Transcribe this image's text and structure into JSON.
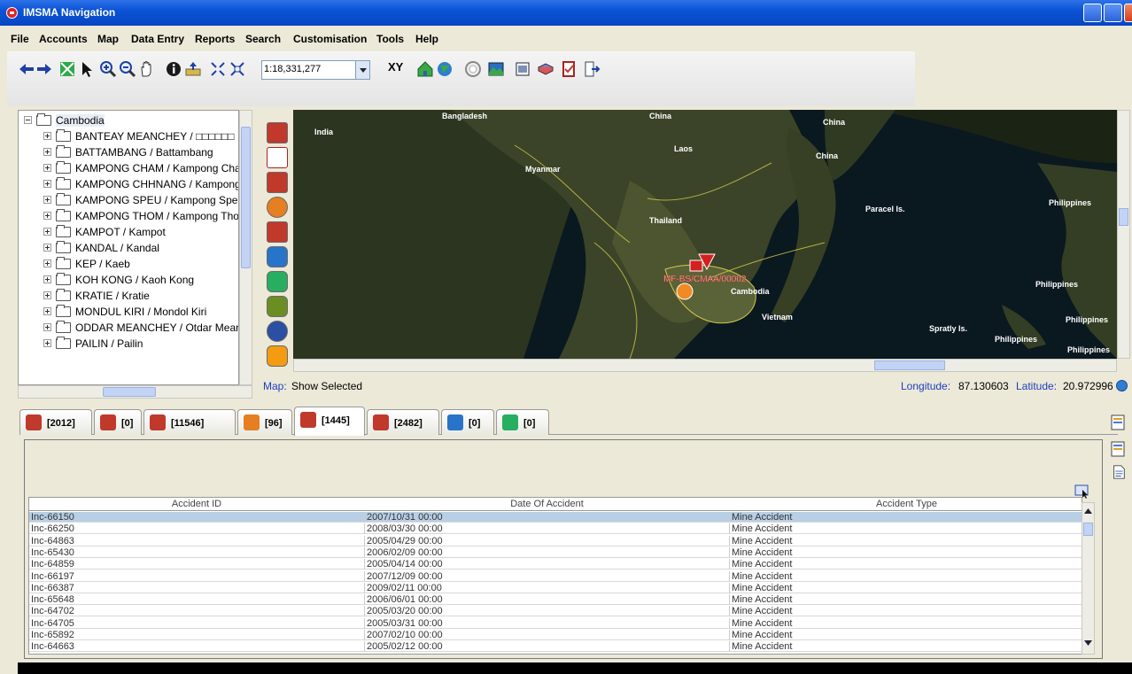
{
  "window": {
    "title": "IMSMA Navigation"
  },
  "menu": [
    "File",
    "Accounts",
    "Map",
    "Data Entry",
    "Reports",
    "Search",
    "Customisation",
    "Tools",
    "Help"
  ],
  "toolbar": {
    "scale": "1:18,331,277",
    "xy_label": "XY"
  },
  "tree": {
    "root": "Cambodia",
    "items": [
      "BANTEAY MEANCHEY / □□□□□□",
      "BATTAMBANG / Battambang",
      "KAMPONG CHAM / Kampong Cha",
      "KAMPONG CHHNANG / Kampong",
      "KAMPONG SPEU / Kampong Spe",
      "KAMPONG THOM / Kampong Tho",
      "KAMPOT / Kampot",
      "KANDAL / Kandal",
      "KEP / Kaeb",
      "KOH KONG / Kaoh Kong",
      "KRATIE / Kratie",
      "MONDUL KIRI / Mondol Kiri",
      "ODDAR MEANCHEY / Otdar Mean",
      "PAILIN / Pailin"
    ]
  },
  "map": {
    "labels": [
      "Bangladesh",
      "China",
      "China",
      "China",
      "India",
      "Laos",
      "Myanmar",
      "Thailand",
      "Paracel Is.",
      "Philippines",
      "Philippines",
      "Philippines",
      "Cambodia",
      "Vietnam",
      "Spratly Is.",
      "Philippines",
      "Philippines"
    ],
    "marker_label": "MF-BS/CMAA/00002",
    "status_prefix": "Map:",
    "status_text": "Show Selected",
    "lon_label": "Longitude:",
    "lon_value": "87.130603",
    "lat_label": "Latitude:",
    "lat_value": "20.972996"
  },
  "tabs": [
    {
      "count": "[2012]",
      "color": "#c0392b",
      "icon": "accident-icon"
    },
    {
      "count": "[0]",
      "color": "#c0392b",
      "icon": "checklist-icon"
    },
    {
      "count": "[11546]",
      "color": "#c0392b",
      "icon": "mine-icon"
    },
    {
      "count": "[96]",
      "color": "#e67e22",
      "icon": "hazard-icon"
    },
    {
      "count": "[1445]",
      "color": "#c0392b",
      "icon": "explosion-icon"
    },
    {
      "count": "[2482]",
      "color": "#c0392b",
      "icon": "victim-icon"
    },
    {
      "count": "[0]",
      "color": "#2874c9",
      "icon": "education-icon"
    },
    {
      "count": "[0]",
      "color": "#27ae60",
      "icon": "completed-icon"
    }
  ],
  "table": {
    "columns": [
      "Accident ID",
      "Date Of Accident",
      "Accident Type"
    ],
    "rows": [
      [
        "Inc-66150",
        "2007/10/31 00:00",
        "Mine Accident"
      ],
      [
        "Inc-66250",
        "2008/03/30 00:00",
        "Mine Accident"
      ],
      [
        "Inc-64863",
        "2005/04/29 00:00",
        "Mine Accident"
      ],
      [
        "Inc-65430",
        "2006/02/09 00:00",
        "Mine Accident"
      ],
      [
        "Inc-64859",
        "2005/04/14 00:00",
        "Mine Accident"
      ],
      [
        "Inc-66197",
        "2007/12/09 00:00",
        "Mine Accident"
      ],
      [
        "Inc-66387",
        "2009/02/11 00:00",
        "Mine Accident"
      ],
      [
        "Inc-65648",
        "2006/06/01 00:00",
        "Mine Accident"
      ],
      [
        "Inc-64702",
        "2005/03/20 00:00",
        "Mine Accident"
      ],
      [
        "Inc-64705",
        "2005/03/31 00:00",
        "Mine Accident"
      ],
      [
        "Inc-65892",
        "2007/02/10 00:00",
        "Mine Accident"
      ],
      [
        "Inc-64663",
        "2005/02/12 00:00",
        "Mine Accident"
      ]
    ]
  }
}
